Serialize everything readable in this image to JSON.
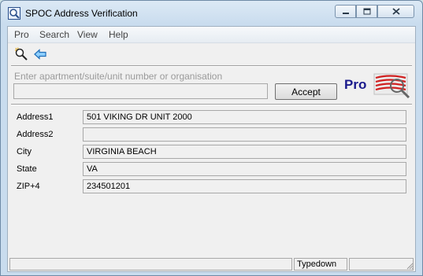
{
  "window": {
    "title": "SPOC Address Verification"
  },
  "menu": {
    "items": [
      "Pro",
      "Search",
      "View",
      "Help"
    ]
  },
  "toolbar": {
    "search_icon": "search-wand-icon",
    "back_icon": "back-arrow-icon"
  },
  "entry": {
    "prompt": "Enter apartment/suite/unit number or organisation",
    "value": "",
    "accept_label": "Accept"
  },
  "logo": {
    "text": "Pro"
  },
  "fields": [
    {
      "label": "Address1",
      "value": "501 VIKING DR UNIT 2000"
    },
    {
      "label": "Address2",
      "value": ""
    },
    {
      "label": "City",
      "value": "VIRGINIA BEACH"
    },
    {
      "label": "State",
      "value": "VA"
    },
    {
      "label": "ZIP+4",
      "value": "234501201"
    }
  ],
  "status": {
    "panel1": "",
    "mode": "Typedown",
    "panel3": ""
  },
  "colors": {
    "logo_blue": "#1a1a8c",
    "logo_red": "#d02020",
    "back_arrow": "#1f8ee8"
  }
}
